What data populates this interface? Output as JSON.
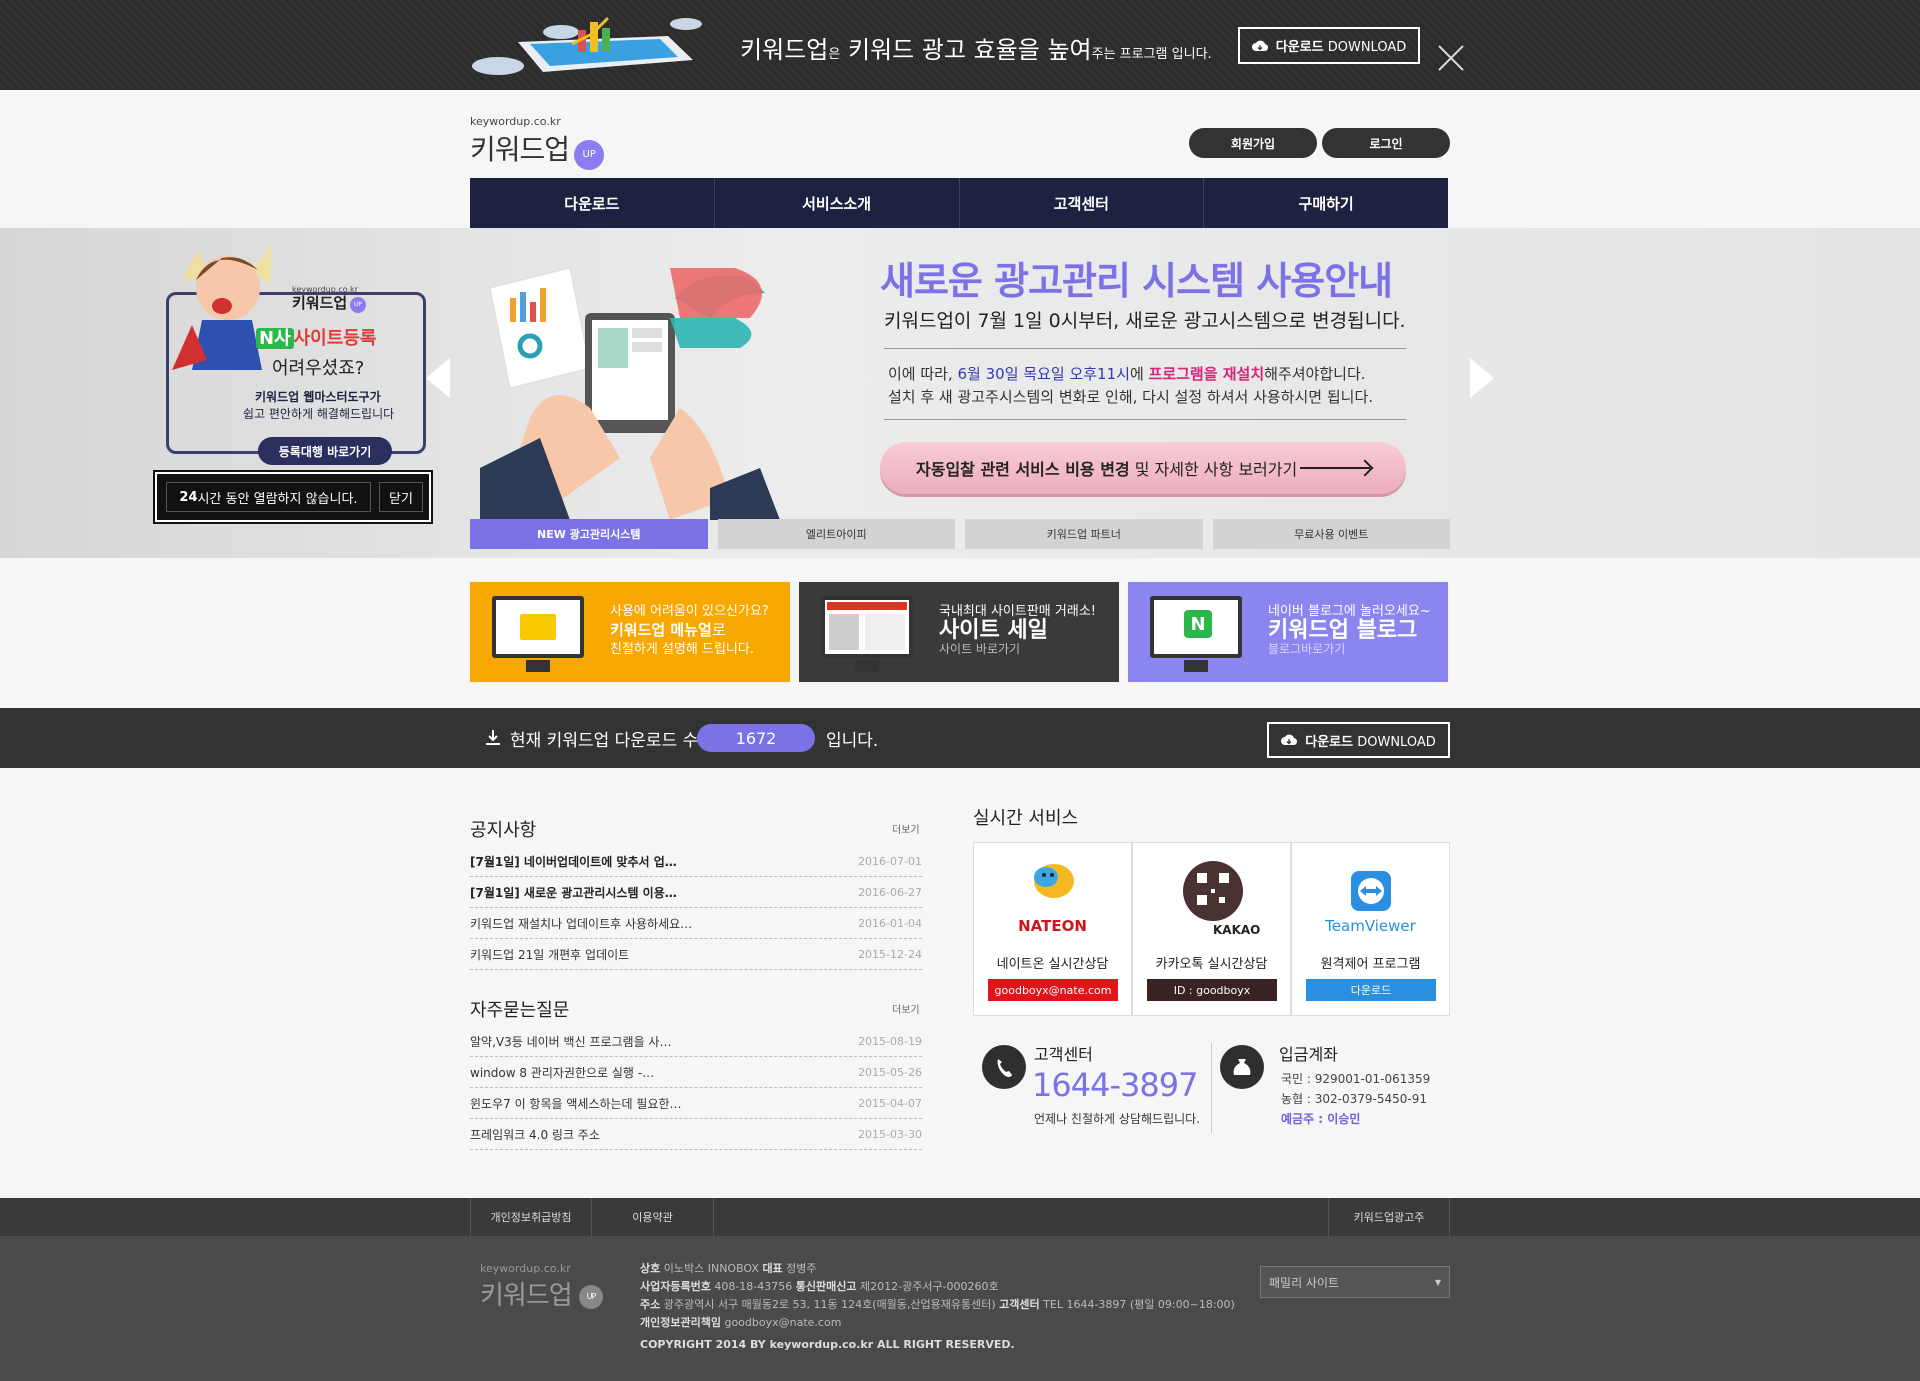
{
  "promo": {
    "brand": "키워드업",
    "particle": "은",
    "headline": "키워드 광고 효율을 높여",
    "tail": "주는 프로그램 입니다.",
    "download_bold": "다운로드",
    "download_rest": " DOWNLOAD"
  },
  "header": {
    "logo_domain": "keywordup.co.kr",
    "logo_name": "키워드업",
    "logo_badge": "UP",
    "signup": "회원가입",
    "login": "로그인"
  },
  "nav": [
    "다운로드",
    "서비스소개",
    "고객센터",
    "구매하기"
  ],
  "popup": {
    "logo_domain": "keywordup.co.kr",
    "logo_name": "키워드업",
    "n_mark": "N사",
    "highlight": "사이트등록",
    "question": "어려우셨죠?",
    "line1": "키워드업 웹마스터도구가",
    "line2": "쉽고 편안하게 해결해드립니다",
    "cta": "등록대행 바로가기",
    "hide_24h_bold": "24",
    "hide_24h": "시간 동안 열람하지 않습니다.",
    "close": "닫기"
  },
  "hero": {
    "title": "새로운 광고관리 시스템 사용안내",
    "subtitle": "키워드업이 7월 1일 0시부터, 새로운 광고시스템으로 변경됩니다.",
    "line1_a": "이에 따라, ",
    "line1_date": "6월 30일 목요일 오후11시",
    "line1_b": "에 ",
    "line1_pink": "프로그램을 재설치",
    "line1_c": "해주셔야합니다.",
    "line2": "설치 후 새 광고주시스템의 변화로 인해, 다시 설정 하셔서 사용하시면 됩니다.",
    "cta_bold": "자동입찰 관련 서비스 비용 변경",
    "cta_rest": " 및 자세한 사항 보러가기",
    "tabs": [
      "NEW 광고관리시스템",
      "엘리트아이피",
      "키워드업 파트너",
      "무료사용 이벤트"
    ]
  },
  "banners": [
    {
      "line1": "사용에 어려움이 있으신가요?",
      "big": "키워드업 메뉴얼",
      "big_tail": "로",
      "line3": "친절하게 설명해 드립니다.",
      "color": "#f7a800"
    },
    {
      "line1": "국내최대 사이트판매 거래소!",
      "big": "사이트 세일",
      "line3": "사이트 바로가기",
      "color": "#3a3a3a"
    },
    {
      "line1": "네이버 블로그에 놀러오세요~",
      "big": "키워드업 블로그",
      "line3": "블로그바로가기",
      "color": "#8b85f0",
      "icon": "N"
    }
  ],
  "counter": {
    "label": "현재 키워드업 다운로드 수",
    "count": "1672",
    "suffix": "입니다.",
    "download_bold": "다운로드",
    "download_rest": " DOWNLOAD"
  },
  "notice": {
    "title": "공지사항",
    "more": "더보기",
    "items": [
      {
        "text": "[7월1일] 네이버업데이트에 맞추서 업…",
        "date": "2016-07-01",
        "bold": true
      },
      {
        "text": "[7월1일] 새로운 광고관리시스템 이용…",
        "date": "2016-06-27",
        "bold": true
      },
      {
        "text": "키워드업 재설치나 업데이트후 사용하세요…",
        "date": "2016-01-04",
        "bold": false
      },
      {
        "text": "키워드업 21일 개편후 업데이트",
        "date": "2015-12-24",
        "bold": false
      }
    ]
  },
  "faq": {
    "title": "자주묻는질문",
    "more": "더보기",
    "items": [
      {
        "text": "알약,V3등 네이버 백신 프로그램을 사…",
        "date": "2015-08-19"
      },
      {
        "text": "window 8 관리자권한으로 실행 -…",
        "date": "2015-05-26"
      },
      {
        "text": "윈도우7 이 항목을 액세스하는데 필요한…",
        "date": "2015-04-07"
      },
      {
        "text": "프레임워크 4.0 링크 주소",
        "date": "2015-03-30"
      }
    ]
  },
  "realtime": {
    "title": "실시간 서비스",
    "services": [
      {
        "brand": "NATEON",
        "name": "네이트온 실시간상담",
        "tag": "goodboyx@nate.com",
        "color": "#e0141a"
      },
      {
        "brand": "KAKAO",
        "name": "카카오톡 실시간상담",
        "tag": "ID : goodboyx",
        "color": "#3a2222"
      },
      {
        "brand": "TeamViewer",
        "name": "원격제어 프로그램",
        "tag": "다운로드",
        "color": "#2a8fe0"
      }
    ]
  },
  "support": {
    "title": "고객센터",
    "phone": "1644-3897",
    "note": "언제나 친절하게 상담해드립니다."
  },
  "bank": {
    "title": "입금계좌",
    "line1": "국민 : 929001-01-061359",
    "line2": "농협 : 302-0379-5450-91",
    "holder": "예금주 : 이승민"
  },
  "footer": {
    "links": [
      "개인정보취급방침",
      "이용약관"
    ],
    "right_link": "키워드업광고주",
    "logo_domain": "keywordup.co.kr",
    "logo_name": "키워드업",
    "l1_k1": "상호",
    "l1_v1": " 이노박스 INNOBOX ",
    "l1_k2": "대표",
    "l1_v2": " 정병주",
    "l2_k1": "사업자등록번호",
    "l2_v1": " 408-18-43756 ",
    "l2_k2": "통신판매신고",
    "l2_v2": " 제2012-광주서구-000260호",
    "l3_k1": "주소",
    "l3_v1": " 광주광역시 서구 매월동2로 53, 11동 124호(매월동,산업용재유통센터) ",
    "l3_k2": "고객센터",
    "l3_v2": " TEL 1644-3897 (평일 09:00~18:00)",
    "l4_k1": "개인정보관리책임",
    "l4_v1": " goodboyx@nate.com",
    "copyright": "COPYRIGHT 2014 BY keywordup.co.kr ALL RIGHT RESERVED.",
    "family_site": "패밀리 사이트"
  }
}
